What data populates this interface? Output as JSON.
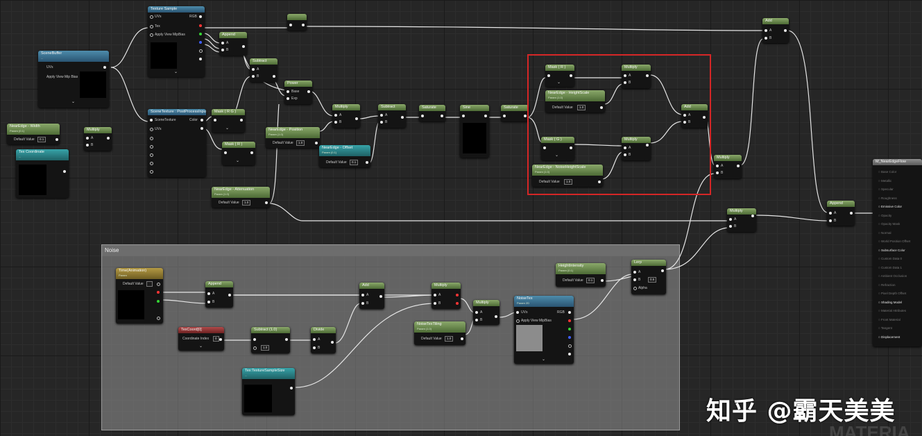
{
  "comment": {
    "title": "Noise"
  },
  "watermark": "知乎 @霸天美美",
  "corner_text": "MATERIA",
  "nodes": {
    "texture_sample": {
      "title": "Texture Sample",
      "pins": [
        "UVs",
        "Tex",
        "Apply View MipBias"
      ],
      "outs": [
        "RGB",
        "R",
        "G",
        "B",
        "A",
        "RGBA"
      ]
    },
    "scene_buffer": {
      "title": "SceneBuffer",
      "sub": "...",
      "pins": [
        "UVs",
        "Apply View Mip Bias"
      ]
    },
    "nearedge_width": {
      "title": "NearEdge - Width",
      "sub": "Param (0.1)",
      "field_label": "Default Value",
      "field_value": "0.1"
    },
    "multiply_left": {
      "title": "Multiply",
      "pins": [
        "A",
        "B"
      ]
    },
    "tex_coordinate_small": {
      "title": "Tex Coordinate",
      "sub": "..."
    },
    "append_top": {
      "title": "Append",
      "pins": [
        "A",
        "B"
      ]
    },
    "subtract_top": {
      "title": "Subtract",
      "pins": [
        "A",
        "B"
      ]
    },
    "scene_texture": {
      "title": "SceneTexture : PostProcessInput0",
      "pins": [
        "SceneTexture",
        "UVs"
      ],
      "outs": [
        "Color",
        "Size",
        "InvSize"
      ]
    },
    "mask_rg": {
      "title": "Mask ( R G )"
    },
    "mask_r": {
      "title": "Mask ( R )"
    },
    "power": {
      "title": "Power",
      "pins": [
        "Base",
        "Exp"
      ]
    },
    "nearedge_position": {
      "title": "NearEdge - Position",
      "sub": "Param (1.0)",
      "field_label": "Default Value",
      "field_value": "1.0"
    },
    "nearedge_offset": {
      "title": "NearEdge - Offset",
      "sub": "Param (0.1)",
      "field_label": "Default Value",
      "field_value": "0.1"
    },
    "nearedge_attenuation": {
      "title": "NearEdge - Attenuation",
      "sub": "Param (1.0)",
      "field_label": "Default Value",
      "field_value": "1.0"
    },
    "multiply_mid": {
      "title": "Multiply",
      "pins": [
        "A",
        "B"
      ]
    },
    "subtract_mid": {
      "title": "Subtract",
      "pins": [
        "A",
        "B"
      ]
    },
    "saturate_1": {
      "title": "Saturate"
    },
    "sine": {
      "title": "Sine"
    },
    "saturate_2": {
      "title": "Saturate"
    },
    "mask_r_box": {
      "title": "Mask ( R )"
    },
    "mask_g_box": {
      "title": "Mask ( G )"
    },
    "nearedge_heightscale": {
      "title": "NearEdge - HeightScale",
      "sub": "Param (1.0)",
      "field_label": "Default Value",
      "field_value": "1.0"
    },
    "nearedge_noiseheight": {
      "title": "NearEdge - NoiseHeightScale",
      "sub": "Param (1.0)",
      "field_label": "Default Value",
      "field_value": "1.0"
    },
    "multiply_box_1": {
      "title": "Multiply",
      "pins": [
        "A",
        "B"
      ]
    },
    "multiply_box_2": {
      "title": "Multiply",
      "pins": [
        "A",
        "B"
      ]
    },
    "add_box": {
      "title": "Add",
      "pins": [
        "A",
        "B"
      ]
    },
    "multiply_right": {
      "title": "Multiply",
      "pins": [
        "A",
        "B"
      ]
    },
    "add_top_right": {
      "title": "Add",
      "pins": [
        "A",
        "B"
      ]
    },
    "multiply_lower_right": {
      "title": "Multiply",
      "pins": [
        "A",
        "B"
      ]
    },
    "append_right": {
      "title": "Append",
      "pins": [
        "A",
        "B"
      ]
    },
    "output": {
      "title": "M_NearEdgeFlow",
      "rows": [
        "Base Color",
        "Metallic",
        "Specular",
        "Roughness",
        "Emissive Color",
        "Opacity",
        "Opacity Mask",
        "Normal",
        "World Position Offset",
        "Subsurface Color",
        "Custom Data 0",
        "Custom Data 1",
        "Ambient Occlusion",
        "Refraction",
        "Pixel Depth Offset",
        "Shading Model",
        "Material Attributes",
        "Front Material",
        "Tangent",
        "Displacement"
      ],
      "active": [
        5,
        10,
        16,
        20
      ]
    },
    "time_noise": {
      "title": "Time(Animation)",
      "sub": "Param",
      "field_label": "Default Value"
    },
    "append_noise": {
      "title": "Append",
      "pins": [
        "A",
        "B"
      ]
    },
    "texcoord_noise": {
      "title": "TexCoord[0]",
      "field_label": "Coordinate Index",
      "field_value": "0"
    },
    "subtract_noise": {
      "title": "Subtract (1.0)",
      "field_value": "1.0"
    },
    "divide_noise": {
      "title": "Divide",
      "pins": [
        "A",
        "B"
      ]
    },
    "add_noise": {
      "title": "Add",
      "pins": [
        "A",
        "B"
      ]
    },
    "multiply_noise_1": {
      "title": "Multiply",
      "pins": [
        "A",
        "B"
      ]
    },
    "multiply_noise_2": {
      "title": "Multiply",
      "pins": [
        "A",
        "B"
      ]
    },
    "noise_tiling": {
      "title": "NoiseTexTiling",
      "sub": "Param (1.0)",
      "field_label": "Default Value",
      "field_value": "1.0"
    },
    "tex_noise_scale": {
      "title": "Tex:TextureSampleSize",
      "sub": "..."
    },
    "noise_tex": {
      "title": "NoiseTex",
      "sub": "Param 2D",
      "pins": [
        "UVs",
        "Apply View MipBias"
      ],
      "outs": [
        "RGB",
        "R",
        "G",
        "B",
        "A",
        "RGBA"
      ]
    },
    "height_intensity": {
      "title": "HeightIntensity",
      "sub": "Param (0.1)",
      "field_label": "Default Value",
      "field_value": "0.1"
    },
    "lerp_noise": {
      "title": "Lerp",
      "pins": [
        "A",
        "B",
        "Alpha"
      ],
      "field_value": "0.5"
    }
  }
}
